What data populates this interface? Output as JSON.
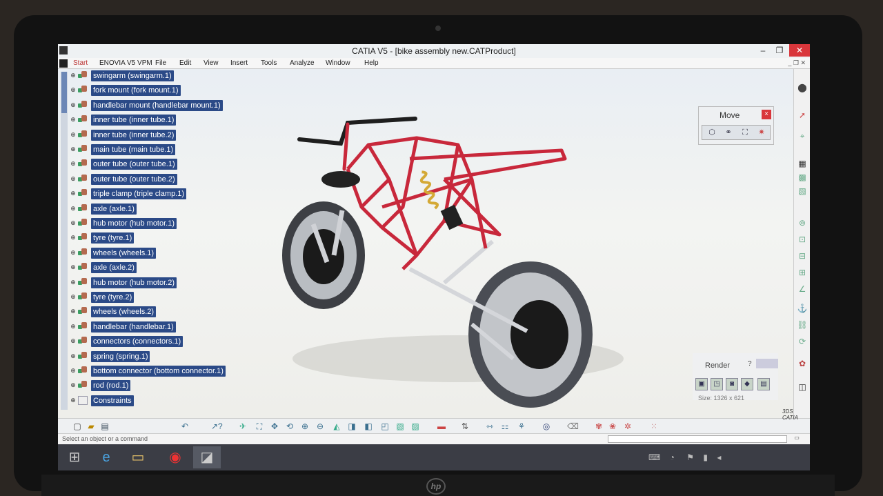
{
  "window": {
    "title": "CATIA V5 - [bike assembly new.CATProduct]",
    "min": "–",
    "max": "❐",
    "close": "✕"
  },
  "menu": [
    "Start",
    "ENOVIA V5 VPM",
    "File",
    "Edit",
    "View",
    "Insert",
    "Tools",
    "Analyze",
    "Window",
    "Help"
  ],
  "tree": [
    "swingarm (swingarm.1)",
    "fork mount (fork mount.1)",
    "handlebar mount (handlebar mount.1)",
    "inner tube (inner tube.1)",
    "inner tube (inner tube.2)",
    "main tube (main tube.1)",
    "outer tube (outer tube.1)",
    "outer tube (outer tube.2)",
    "triple clamp (triple clamp.1)",
    "axle (axle.1)",
    "hub motor (hub motor.1)",
    "tyre (tyre.1)",
    "wheels (wheels.1)",
    "axle (axle.2)",
    "hub motor (hub motor.2)",
    "tyre (tyre.2)",
    "wheels (wheels.2)",
    "handlebar (handlebar.1)",
    "connectors (connectors.1)",
    "spring (spring.1)",
    "bottom connector (bottom connector.1)",
    "rod (rod.1)",
    "Constraints"
  ],
  "move_panel": {
    "title": "Move",
    "close": "×"
  },
  "render_panel": {
    "title": "Render",
    "help": "?",
    "size": "Size: 1326 x 621"
  },
  "status": {
    "text": "Select an object or a command"
  },
  "colors": {
    "frame_red": "#c8283b",
    "tree_highlight": "#2b4a87",
    "close_red": "#d9363b"
  }
}
